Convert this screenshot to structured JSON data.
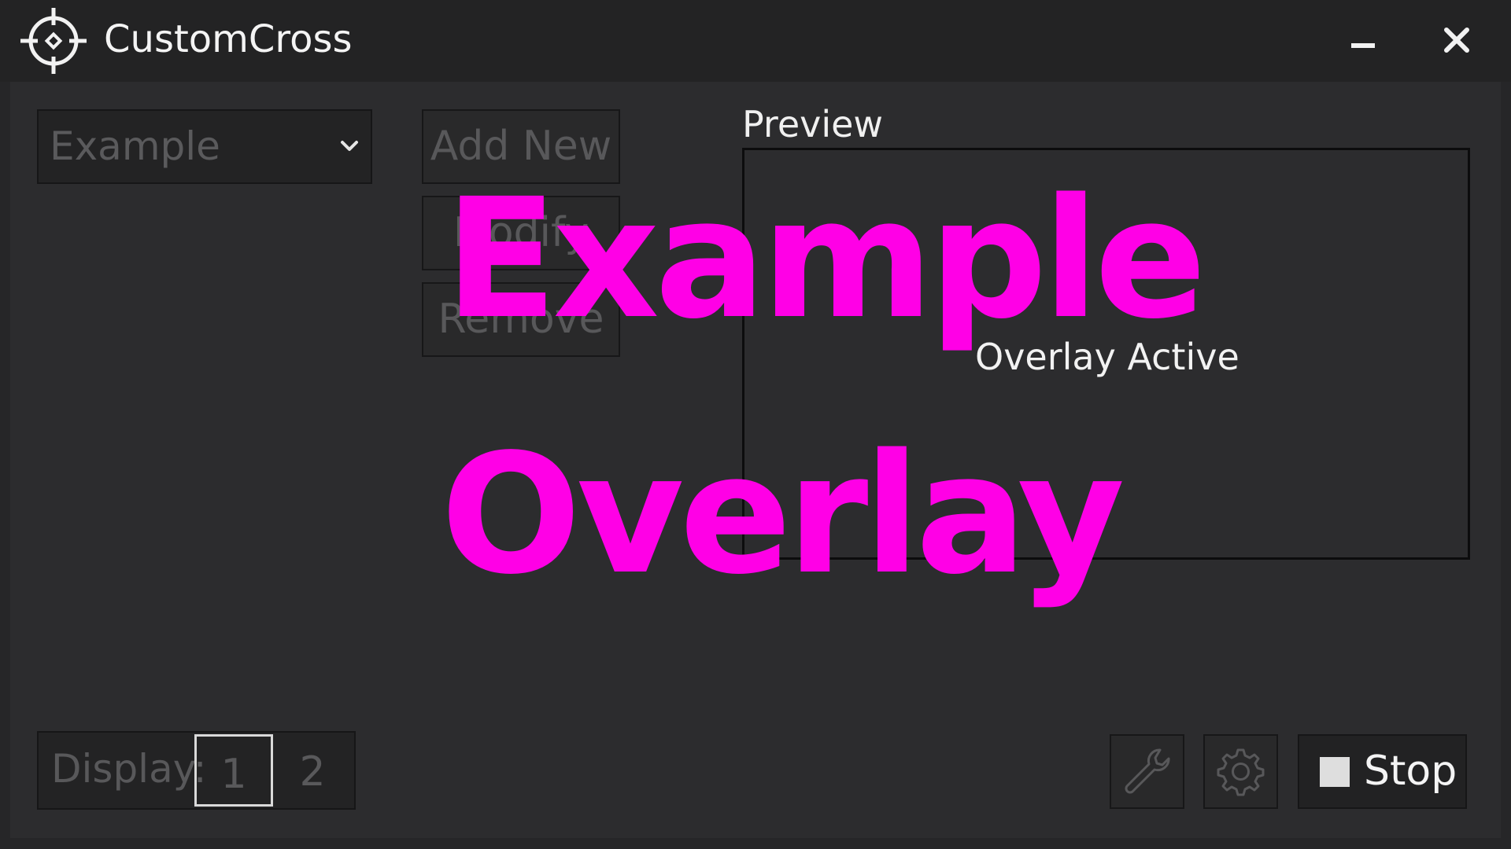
{
  "window": {
    "title": "CustomCross",
    "icon": "crosshair-icon",
    "controls": {
      "minimize": "minimize-icon",
      "close": "close-icon"
    }
  },
  "profile": {
    "selected": "Example",
    "dropdown_icon": "chevron-down-icon"
  },
  "actions": {
    "add_label": "Add New",
    "modify_label": "Modify",
    "remove_label": "Remove"
  },
  "preview": {
    "label": "Preview",
    "status": "Overlay Active"
  },
  "display": {
    "label": "Display:",
    "options": [
      "1",
      "2"
    ],
    "selected": "1"
  },
  "toolbar": {
    "tools_icon": "wrench-icon",
    "settings_icon": "gear-icon",
    "stop_label": "Stop",
    "stop_icon": "stop-square-icon"
  },
  "overlay": {
    "line1": "Example",
    "line2": "Overlay",
    "color": "#ff00e6"
  },
  "colors": {
    "window_bg": "#262628",
    "titlebar_bg": "#232324",
    "content_bg": "#2c2c2e",
    "text_primary": "#f4f4f4",
    "text_dim": "#58585a"
  }
}
